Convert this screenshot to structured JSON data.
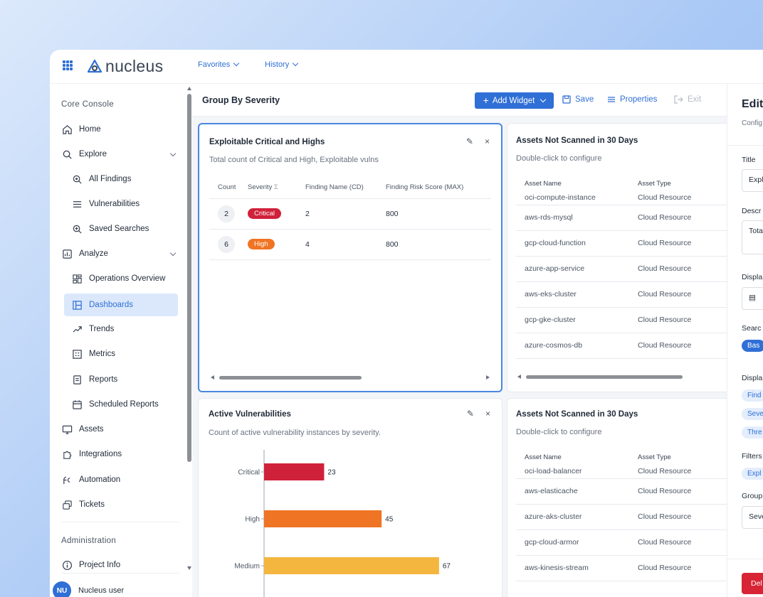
{
  "app": {
    "logo_text": "nucleus"
  },
  "topnav": {
    "favorites": "Favorites",
    "history": "History"
  },
  "sidebar": {
    "section_core": "Core Console",
    "home": "Home",
    "explore": "Explore",
    "all_findings": "All Findings",
    "vulnerabilities": "Vulnerabilities",
    "saved_searches": "Saved Searches",
    "analyze": "Analyze",
    "operations_overview": "Operations Overview",
    "dashboards": "Dashboards",
    "trends": "Trends",
    "metrics": "Metrics",
    "reports": "Reports",
    "scheduled_reports": "Scheduled Reports",
    "assets": "Assets",
    "integrations": "Integrations",
    "automation": "Automation",
    "tickets": "Tickets",
    "section_admin": "Administration",
    "project_info": "Project Info",
    "user_initials": "NU",
    "user_name": "Nucleus user"
  },
  "toolbar": {
    "title": "Group By Severity",
    "add_widget": "Add Widget",
    "save": "Save",
    "properties": "Properties",
    "exit": "Exit"
  },
  "widget1": {
    "title": "Exploitable Critical and Highs",
    "description": "Total count of Critical and High, Exploitable vulns",
    "columns": [
      "Count",
      "Severity",
      "Finding Name (CD)",
      "Finding Risk Score (MAX)"
    ],
    "rows": [
      {
        "count": "2",
        "severity": "Critical",
        "finding": "2",
        "score": "800"
      },
      {
        "count": "6",
        "severity": "High",
        "finding": "4",
        "score": "800"
      }
    ]
  },
  "widget2": {
    "title": "Assets Not Scanned in 30 Days",
    "description": "Double-click to configure",
    "columns": [
      "Asset Name",
      "Asset Type"
    ],
    "rows": [
      [
        "oci-compute-instance",
        "Cloud Resource"
      ],
      [
        "aws-rds-mysql",
        "Cloud Resource"
      ],
      [
        "gcp-cloud-function",
        "Cloud Resource"
      ],
      [
        "azure-app-service",
        "Cloud Resource"
      ],
      [
        "aws-eks-cluster",
        "Cloud Resource"
      ],
      [
        "gcp-gke-cluster",
        "Cloud Resource"
      ],
      [
        "azure-cosmos-db",
        "Cloud Resource"
      ]
    ]
  },
  "widget3": {
    "title": "Active Vulnerabilities",
    "description": "Count of active vulnerability instances by severity."
  },
  "widget4": {
    "title": "Assets Not Scanned in 30 Days",
    "description": "Double-click to configure",
    "columns": [
      "Asset Name",
      "Asset Type"
    ],
    "rows": [
      [
        "oci-load-balancer",
        "Cloud Resource"
      ],
      [
        "aws-elasticache",
        "Cloud Resource"
      ],
      [
        "azure-aks-cluster",
        "Cloud Resource"
      ],
      [
        "gcp-cloud-armor",
        "Cloud Resource"
      ],
      [
        "aws-kinesis-stream",
        "Cloud Resource"
      ]
    ]
  },
  "panel": {
    "heading": "Edit",
    "sub": "Config",
    "title_label": "Title",
    "title_value": "Expl",
    "desc_label": "Descr",
    "desc_value": "Tota",
    "display_label": "Displa",
    "search_label": "Searc",
    "search_chip": "Bas",
    "display2_label": "Displa",
    "chip_find": "Find",
    "chip_sev": "Seve",
    "chip_thr": "Thre",
    "filters_label": "Filters",
    "filter_chip": "Expl",
    "group_label": "Group",
    "group_value": "Seve",
    "delete": "Del"
  },
  "colors": {
    "accent": "#2f6fd6",
    "critical": "#d0213a",
    "high": "#ef7423",
    "medium": "#f4b63f"
  },
  "chart_data": {
    "type": "bar",
    "orientation": "horizontal",
    "categories": [
      "Critical",
      "High",
      "Medium"
    ],
    "values": [
      23,
      45,
      67
    ],
    "xlim": [
      0,
      80
    ],
    "colors": [
      "#d0213a",
      "#ef7423",
      "#f4b63f"
    ]
  }
}
